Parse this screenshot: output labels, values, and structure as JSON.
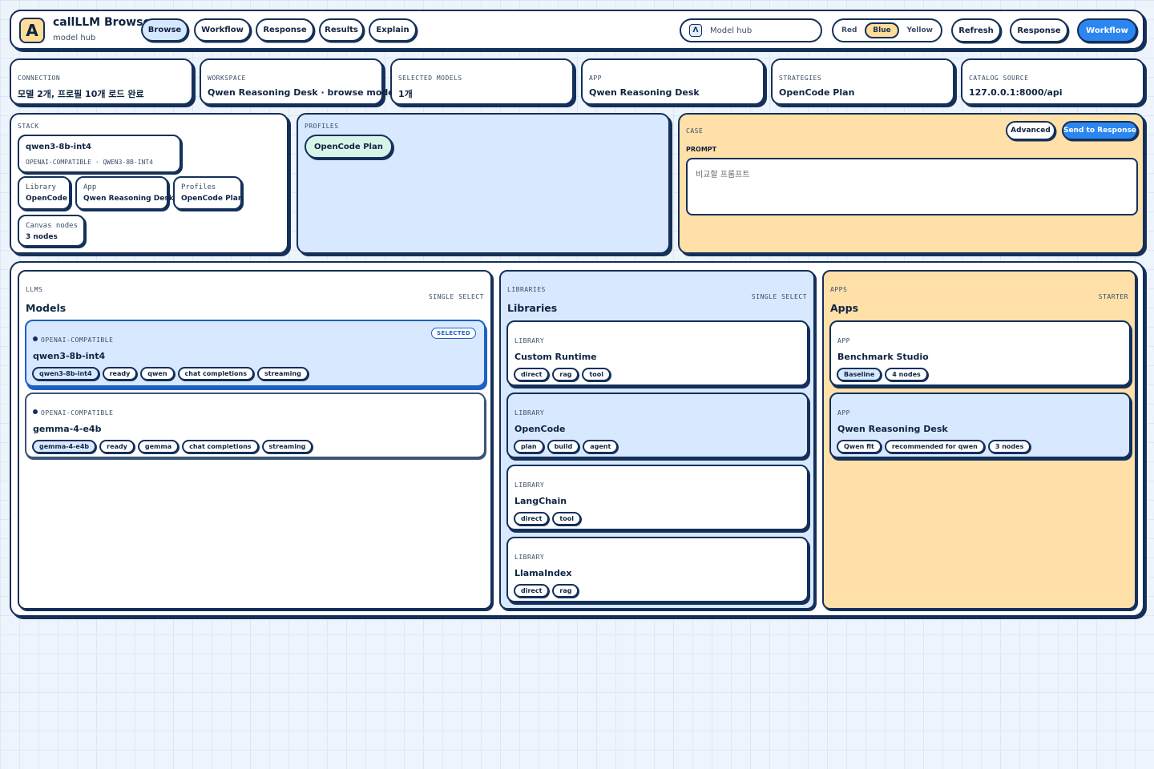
{
  "brand": {
    "logo_letter": "A",
    "title": "callLLM Browse",
    "subtitle": "model hub"
  },
  "nav": {
    "tabs": [
      "Browse",
      "Workflow",
      "Response",
      "Results",
      "Explain"
    ],
    "active": "Browse"
  },
  "search": {
    "icon": "lambda-icon",
    "placeholder": "Model hub"
  },
  "theme": {
    "options": [
      "Red",
      "Blue",
      "Yellow"
    ],
    "selected": "Blue"
  },
  "actions": {
    "refresh": "Refresh",
    "response": "Response",
    "workflow": "Workflow"
  },
  "stats": [
    {
      "label": "CONNECTION",
      "value": "모델 2개, 프로필 10개 로드 완료"
    },
    {
      "label": "WORKSPACE",
      "value": "Qwen Reasoning Desk · browse mode"
    },
    {
      "label": "SELECTED MODELS",
      "value": "1개"
    },
    {
      "label": "APP",
      "value": "Qwen Reasoning Desk"
    },
    {
      "label": "STRATEGIES",
      "value": "OpenCode Plan"
    },
    {
      "label": "CATALOG SOURCE",
      "value": "127.0.0.1:8000/api"
    }
  ],
  "stack": {
    "label": "STACK",
    "model": "qwen3-8b-int4",
    "model_meta": "OPENAI-COMPATIBLE · QWEN3-8B-INT4",
    "cards": [
      {
        "k": "Library",
        "v": "OpenCode"
      },
      {
        "k": "App",
        "v": "Qwen Reasoning Desk"
      },
      {
        "k": "Profiles",
        "v": "OpenCode Plan"
      },
      {
        "k": "Canvas nodes",
        "v": "3 nodes"
      }
    ]
  },
  "profiles": {
    "label": "PROFILES",
    "chip": "OpenCode Plan"
  },
  "case": {
    "label": "CASE",
    "advanced": "Advanced",
    "send": "Send to Response",
    "prompt_label": "PROMPT",
    "prompt_placeholder": "비교할 프롬프트"
  },
  "models": {
    "label": "LLMS",
    "title": "Models",
    "mode": "SINGLE SELECT",
    "items": [
      {
        "kind": "OPENAI-COMPATIBLE",
        "name": "qwen3-8b-int4",
        "selected": true,
        "badge": "SELECTED",
        "tags": [
          "qwen3-8b-int4",
          "ready",
          "qwen",
          "chat completions",
          "streaming"
        ]
      },
      {
        "kind": "OPENAI-COMPATIBLE",
        "name": "gemma-4-e4b",
        "selected": false,
        "tags": [
          "gemma-4-e4b",
          "ready",
          "gemma",
          "chat completions",
          "streaming"
        ]
      }
    ]
  },
  "libraries": {
    "label": "LIBRARIES",
    "title": "Libraries",
    "mode": "SINGLE SELECT",
    "items": [
      {
        "kind": "LIBRARY",
        "name": "Custom Runtime",
        "tags": [
          "direct",
          "rag",
          "tool"
        ],
        "selected": false
      },
      {
        "kind": "LIBRARY",
        "name": "OpenCode",
        "tags": [
          "plan",
          "build",
          "agent"
        ],
        "selected": true
      },
      {
        "kind": "LIBRARY",
        "name": "LangChain",
        "tags": [
          "direct",
          "tool"
        ],
        "selected": false
      },
      {
        "kind": "LIBRARY",
        "name": "LlamaIndex",
        "tags": [
          "direct",
          "rag"
        ],
        "selected": false
      }
    ]
  },
  "apps": {
    "label": "APPS",
    "title": "Apps",
    "mode": "STARTER",
    "items": [
      {
        "kind": "APP",
        "name": "Benchmark Studio",
        "tags": [
          "Baseline",
          "4 nodes"
        ],
        "selected": false
      },
      {
        "kind": "APP",
        "name": "Qwen Reasoning Desk",
        "tags": [
          "Qwen fit",
          "recommended for qwen",
          "3 nodes"
        ],
        "selected": true
      }
    ]
  }
}
